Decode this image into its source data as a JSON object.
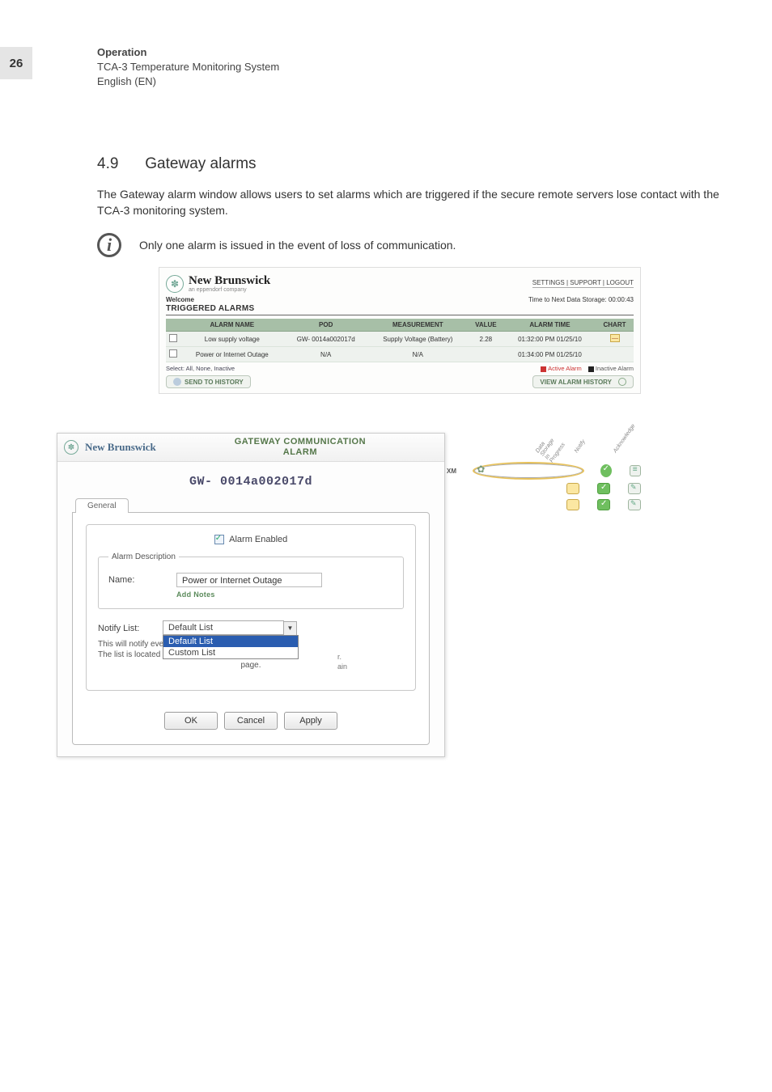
{
  "page": {
    "number": "26",
    "header_bold": "Operation",
    "header_line2": "TCA-3 Temperature Monitoring System",
    "header_line3": "English (EN)"
  },
  "section": {
    "number": "4.9",
    "title": "Gateway alarms",
    "paragraph": "The Gateway alarm window allows users to set alarms which are triggered if the secure remote servers lose contact with the TCA-3 monitoring system.",
    "info_note": "Only one alarm is issued in the event of loss of communication."
  },
  "triggered_alarms": {
    "brand": "New Brunswick",
    "brand_sub": "an eppendorf company",
    "top_links": [
      "SETTINGS",
      "SUPPORT",
      "LOGOUT"
    ],
    "welcome": "Welcome",
    "storage_label": "Time to Next Data Storage: 00:00:43",
    "title": "TRIGGERED ALARMS",
    "columns": [
      "",
      "ALARM NAME",
      "POD",
      "MEASUREMENT",
      "VALUE",
      "ALARM TIME",
      "CHART"
    ],
    "rows": [
      {
        "name": "Low supply voltage",
        "pod": "GW- 0014a002017d",
        "measurement": "Supply Voltage (Battery)",
        "value": "2.28",
        "time": "01:32:00 PM 01/25/10"
      },
      {
        "name": "Power or Internet Outage",
        "pod": "N/A",
        "measurement": "N/A",
        "value": "",
        "time": "01:34:00 PM 01/25/10"
      }
    ],
    "select_label": "Select:",
    "select_opts": [
      "All",
      "None",
      "Inactive"
    ],
    "legend_active": "Active Alarm",
    "legend_inactive": "Inactive Alarm",
    "btn_send": "SEND TO HISTORY",
    "btn_view": "VIEW ALARM HISTORY"
  },
  "understrip": {
    "headers": [
      "Data Storage In Progress",
      "Notify",
      "Acknowledge"
    ],
    "label_xm": "XM"
  },
  "dialog": {
    "brand": "New Brunswick",
    "title": "GATEWAY COMMUNICATION ALARM",
    "gw_id": "GW- 0014a002017d",
    "tab": "General",
    "alarm_enabled_label": "Alarm Enabled",
    "desc_legend": "Alarm Description",
    "name_label": "Name:",
    "name_value": "Power or Internet Outage",
    "add_notes": "Add Notes",
    "notify_label": "Notify List:",
    "notify_selected": "Default List",
    "notify_options": [
      "Default List",
      "Custom List"
    ],
    "notify_note_line1": "This will notify eve",
    "notify_note_line2": "The list is located i",
    "notify_note_page": "page.",
    "cover_frag1": "r.",
    "cover_frag2": "ain",
    "buttons": {
      "ok": "OK",
      "cancel": "Cancel",
      "apply": "Apply"
    }
  }
}
